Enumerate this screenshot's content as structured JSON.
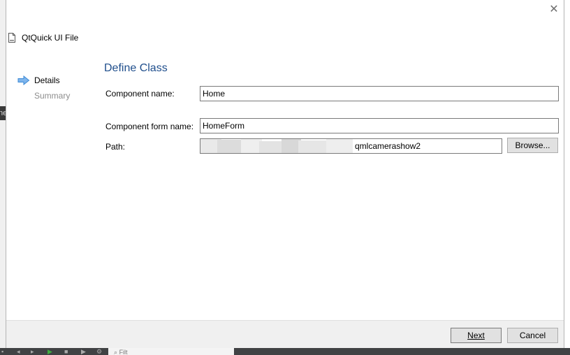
{
  "background": {
    "left_fragment": "ne",
    "filter_placeholder": "Filt"
  },
  "wizard": {
    "title": "QtQuick UI File",
    "close_label": "✕",
    "steps": [
      {
        "label": "Details",
        "current": true
      },
      {
        "label": "Summary",
        "current": false
      }
    ]
  },
  "page": {
    "title": "Define Class",
    "component_name": {
      "label": "Component name:",
      "value": "Home"
    },
    "component_form_name": {
      "label": "Component form name:",
      "value": "HomeForm"
    },
    "path": {
      "label": "Path:",
      "value_visible_suffix": "qmlcamerashow2"
    },
    "browse_label": "Browse..."
  },
  "footer": {
    "next_label": "Next",
    "cancel_label": "Cancel"
  },
  "colors": {
    "title_blue": "#1f4e8c",
    "arrow_blue": "#3c8ad6",
    "footer_bg": "#f0f0f0"
  }
}
